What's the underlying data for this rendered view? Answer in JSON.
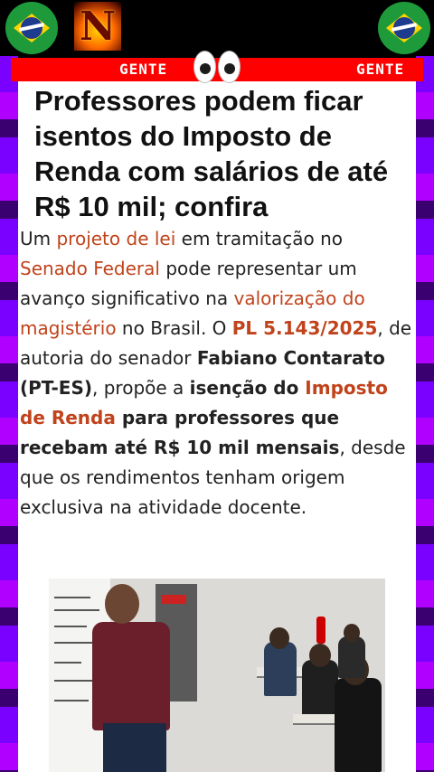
{
  "header": {
    "logo_letter": "N",
    "urgent_label_left": "GENTE",
    "urgent_label_right": "GENTE"
  },
  "article": {
    "headline": "Professores podem ficar isentos do Imposto de Renda com salários de até R$ 10 mil; confira",
    "body": {
      "s1": "Um ",
      "s2": "projeto de lei",
      "s3": " em tramitação no ",
      "s4": "Senado Federal",
      "s5": " pode representar um avanço significativo na ",
      "s6": "valorização do magistério",
      "s7": " no Brasil. O ",
      "s8": "PL 5.143/2025",
      "s9": ", de autoria do senador ",
      "s10": "Fabiano Contarato (PT-ES)",
      "s11": ", propõe a ",
      "s12": "isenção do ",
      "s13": "Imposto de Renda",
      "s14": " para professores que recebam até R$ 10 mil mensais",
      "s15": ", desde que os rendimentos tenham origem exclusiva na atividade docente."
    }
  },
  "icons": {
    "flag": "brazil-flag-icon",
    "eyes": "eyes-emoji-icon",
    "logo": "flaming-n-logo-icon"
  },
  "colors": {
    "accent_red": "#ff0000",
    "link_orange": "#c0431b",
    "side_strip": "#7a00ff"
  }
}
